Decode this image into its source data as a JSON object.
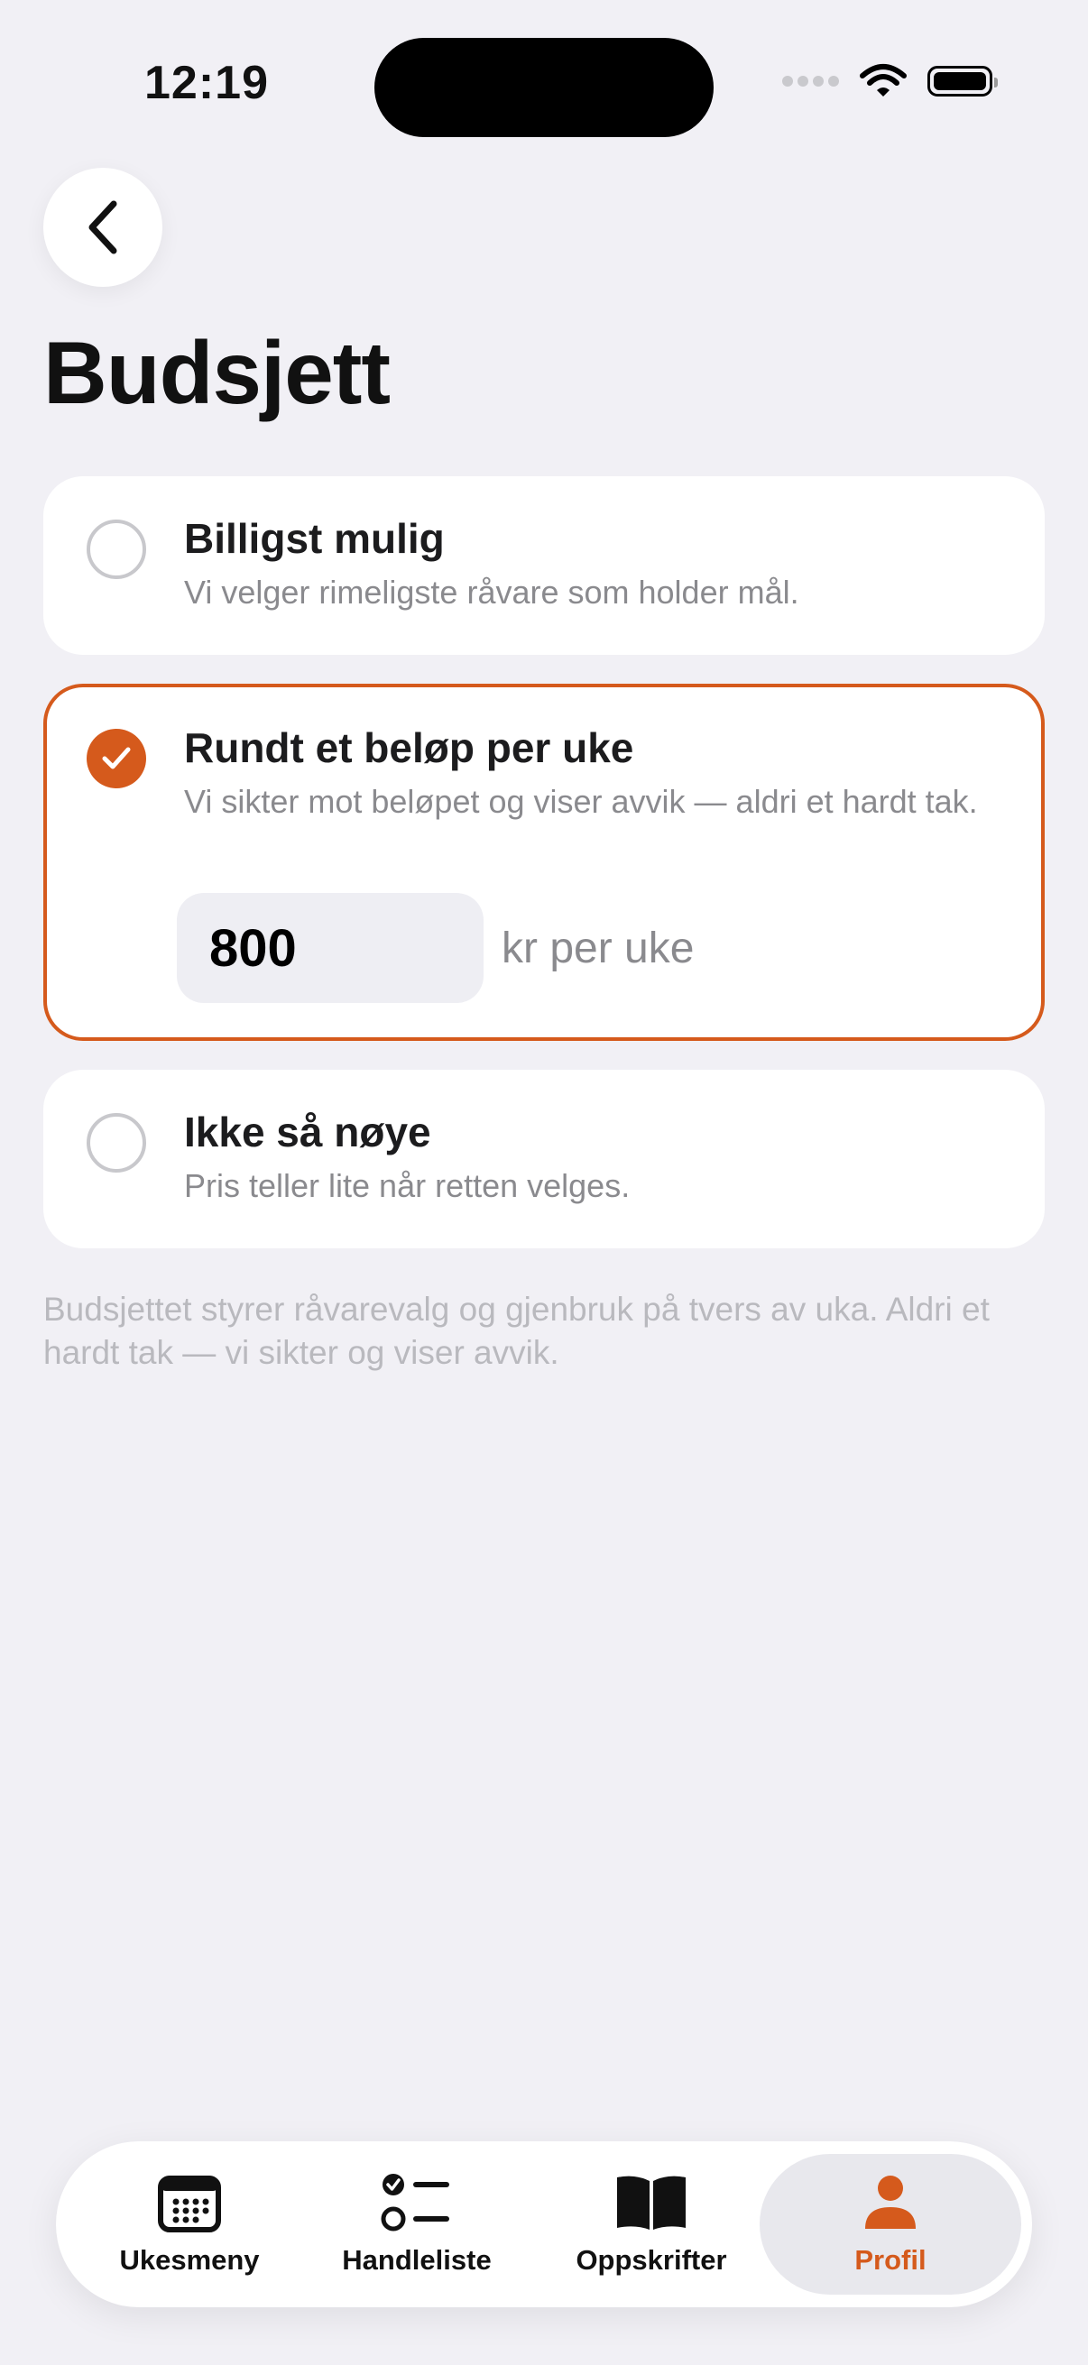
{
  "status_bar": {
    "time": "12:19"
  },
  "header": {
    "title": "Budsjett"
  },
  "options": [
    {
      "title": "Billigst mulig",
      "description": "Vi velger rimeligste råvare som holder mål.",
      "selected": false
    },
    {
      "title": "Rundt et beløp per uke",
      "description": "Vi sikter mot beløpet og viser avvik — aldri et hardt tak.",
      "selected": true,
      "amount": "800",
      "unit": "kr per uke"
    },
    {
      "title": "Ikke så nøye",
      "description": "Pris teller lite når retten velges.",
      "selected": false
    }
  ],
  "footnote": "Budsjettet styrer råvarevalg og gjenbruk på tvers av uka. Aldri et hardt tak — vi sikter og viser avvik.",
  "tabs": [
    {
      "label": "Ukesmeny",
      "icon": "calendar-icon",
      "active": false
    },
    {
      "label": "Handleliste",
      "icon": "checklist-icon",
      "active": false
    },
    {
      "label": "Oppskrifter",
      "icon": "book-icon",
      "active": false
    },
    {
      "label": "Profil",
      "icon": "person-icon",
      "active": true
    }
  ],
  "colors": {
    "accent": "#d55a1c",
    "background": "#f1f0f5",
    "card": "#ffffff",
    "secondary_text": "#8a8a8e"
  }
}
